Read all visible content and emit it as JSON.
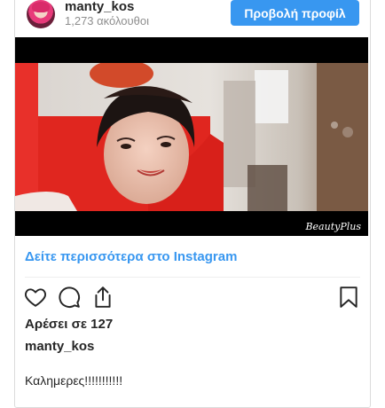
{
  "header": {
    "username": "manty_kos",
    "followers": "1,273 ακόλουθοι",
    "profile_button_label": "Προβολή προφίλ"
  },
  "photo": {
    "watermark": "BeautyPlus"
  },
  "post": {
    "more_link": "Δείτε περισσότερα στο Instagram",
    "likes": "Αρέσει σε 127",
    "caption_username": "manty_kos",
    "caption_text": "Καλημερες!!!!!!!!!!!"
  },
  "icons": {
    "like": "heart-icon",
    "comment": "comment-icon",
    "share": "share-icon",
    "save": "bookmark-icon"
  },
  "colors": {
    "accent": "#3897f0",
    "text": "#262626",
    "muted": "#8e8e8e",
    "border": "#dbdbdb"
  }
}
